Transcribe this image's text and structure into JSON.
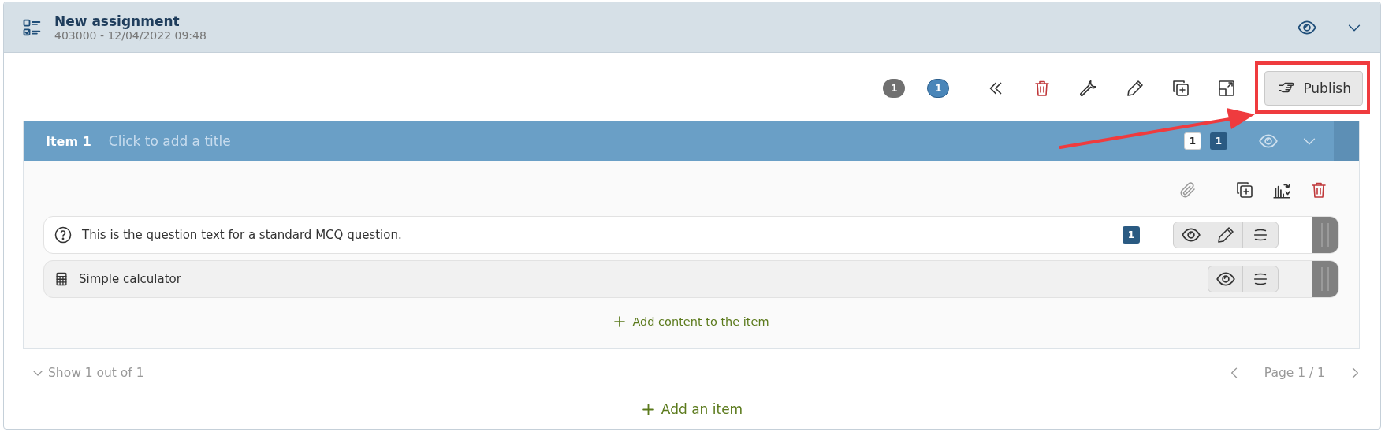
{
  "header": {
    "title": "New assignment",
    "subtitle": "403000 - 12/04/2022 09:48"
  },
  "toolbar": {
    "badges": [
      {
        "label": "1",
        "kind": "grey"
      },
      {
        "label": "1",
        "kind": "blue"
      }
    ],
    "publish_label": "Publish"
  },
  "item": {
    "label": "Item 1",
    "title_placeholder": "Click to add a title",
    "badges": [
      {
        "label": "1",
        "kind": "light"
      },
      {
        "label": "1",
        "kind": "dark"
      }
    ],
    "contents": [
      {
        "kind": "question",
        "text": "This is the question text for a standard MCQ question.",
        "badge": "1",
        "editable": true
      },
      {
        "kind": "calculator",
        "text": "Simple calculator",
        "editable": false
      }
    ],
    "add_content": "Add content to the item"
  },
  "footer": {
    "show_label": "Show 1 out of 1",
    "page_label": "Page 1 / 1"
  },
  "add_item": "Add an item",
  "callouts": {
    "highlight_box": true,
    "pointer_arrow": true
  }
}
